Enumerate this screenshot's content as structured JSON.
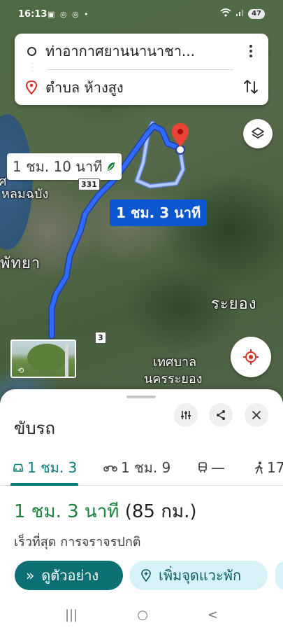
{
  "status_bar": {
    "time": "16:13",
    "left_icons": "▣ ◎ ◎ •",
    "battery": "47"
  },
  "directions": {
    "origin": "ท่าอากาศยานนานาชา...",
    "destination": "ตำบล ห้างสูง"
  },
  "map": {
    "alt_route_label": "1 ชม. 10 นาที",
    "main_route_label": "1 ชม. 3 นาที",
    "road_331": "331",
    "road_3": "3",
    "place_laem_chabang": "หลมฉบัง",
    "place_laem_chabang_prefix": "ศ",
    "place_pattaya": "พัทยา",
    "place_rayong": "ระยอง",
    "place_thesaban_1": "เทศบาล",
    "place_thesaban_2": "นครระยอง",
    "colors": {
      "route_main": "#1a5cff",
      "route_alt": "#a9c3ff",
      "pin": "#ea4335"
    }
  },
  "sheet": {
    "title": "ขับรถ",
    "tabs": [
      {
        "label": "1 ชม. 3",
        "icon": "car-icon",
        "active": true
      },
      {
        "label": "1 ชม. 9",
        "icon": "motorcycle-icon",
        "active": false
      },
      {
        "label": "—",
        "icon": "transit-icon",
        "active": false
      },
      {
        "label": "17",
        "icon": "walk-icon",
        "active": false
      }
    ],
    "route_time": "1 ชม. 3 นาที",
    "route_distance": "(85 กม.)",
    "route_description": "เร็วที่สุด การจราจรปกติ",
    "preview_button": "ดูตัวอย่าง",
    "add_stop_button": "เพิ่มจุดแวะพัก",
    "accent_color": "#0b6f73"
  },
  "nav_bar": {
    "recents": "|||",
    "home": "○",
    "back": "<"
  }
}
